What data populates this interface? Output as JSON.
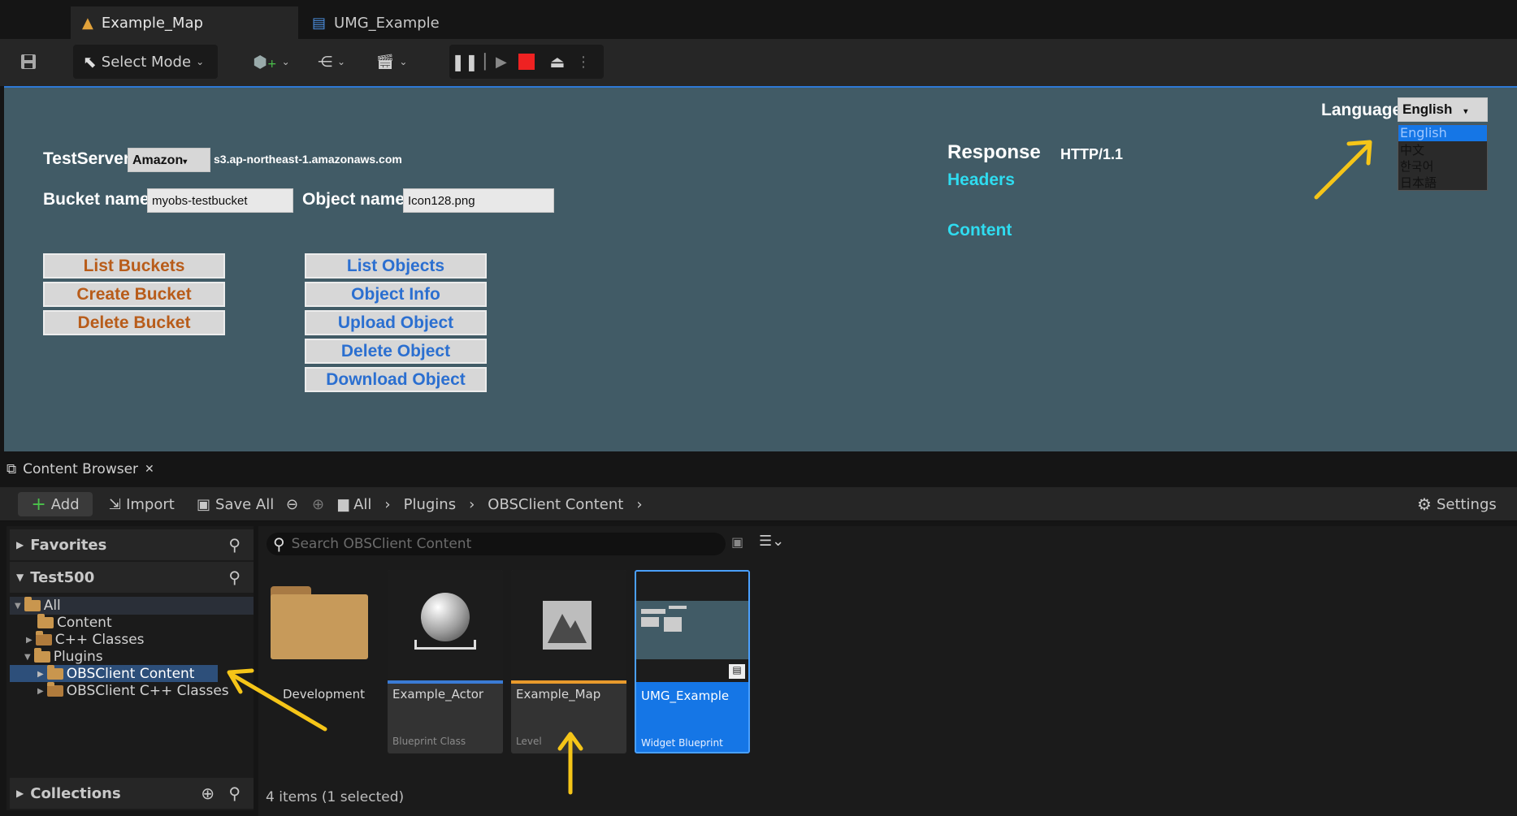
{
  "tabs": [
    {
      "label": "Example_Map",
      "icon": "level-icon",
      "active": true
    },
    {
      "label": "UMG_Example",
      "icon": "widget-icon",
      "active": false
    }
  ],
  "toolbar": {
    "mode_label": "Select Mode"
  },
  "viewport": {
    "test_server_label": "TestServer",
    "server_dropdown": "Amazon",
    "server_host": "s3.ap-northeast-1.amazonaws.com",
    "bucket_label": "Bucket name",
    "bucket_value": "myobs-testbucket",
    "object_label": "Object name",
    "object_value": "Icon128.png",
    "bucket_buttons": [
      "List Buckets",
      "Create Bucket",
      "Delete Bucket"
    ],
    "object_buttons": [
      "List Objects",
      "Object Info",
      "Upload Object",
      "Delete Object",
      "Download Object"
    ],
    "response_label": "Response",
    "response_value": "HTTP/1.1",
    "headers_label": "Headers",
    "content_label": "Content",
    "language_label": "Language",
    "language_selected": "English",
    "language_options": [
      "English",
      "中文",
      "한국어",
      "日本語"
    ]
  },
  "content_browser": {
    "title": "Content Browser",
    "add_label": "Add",
    "import_label": "Import",
    "save_all_label": "Save All",
    "breadcrumb": [
      "All",
      "Plugins",
      "OBSClient Content"
    ],
    "settings_label": "Settings",
    "favorites_label": "Favorites",
    "project_label": "Test500",
    "collections_label": "Collections",
    "search_placeholder": "Search OBSClient Content",
    "tree": [
      {
        "label": "All"
      },
      {
        "label": "Content"
      },
      {
        "label": "C++ Classes"
      },
      {
        "label": "Plugins"
      },
      {
        "label": "OBSClient Content"
      },
      {
        "label": "OBSClient C++ Classes"
      }
    ],
    "assets": [
      {
        "name": "Development",
        "type": ""
      },
      {
        "name": "Example_Actor",
        "type": "Blueprint Class"
      },
      {
        "name": "Example_Map",
        "type": "Level"
      },
      {
        "name": "UMG_Example",
        "type": "Widget Blueprint"
      }
    ],
    "status": "4 items (1 selected)"
  },
  "colors": {
    "viewport_bg": "#415b66",
    "selection": "#1576e6",
    "annotation_arrow": "#f5c518"
  }
}
